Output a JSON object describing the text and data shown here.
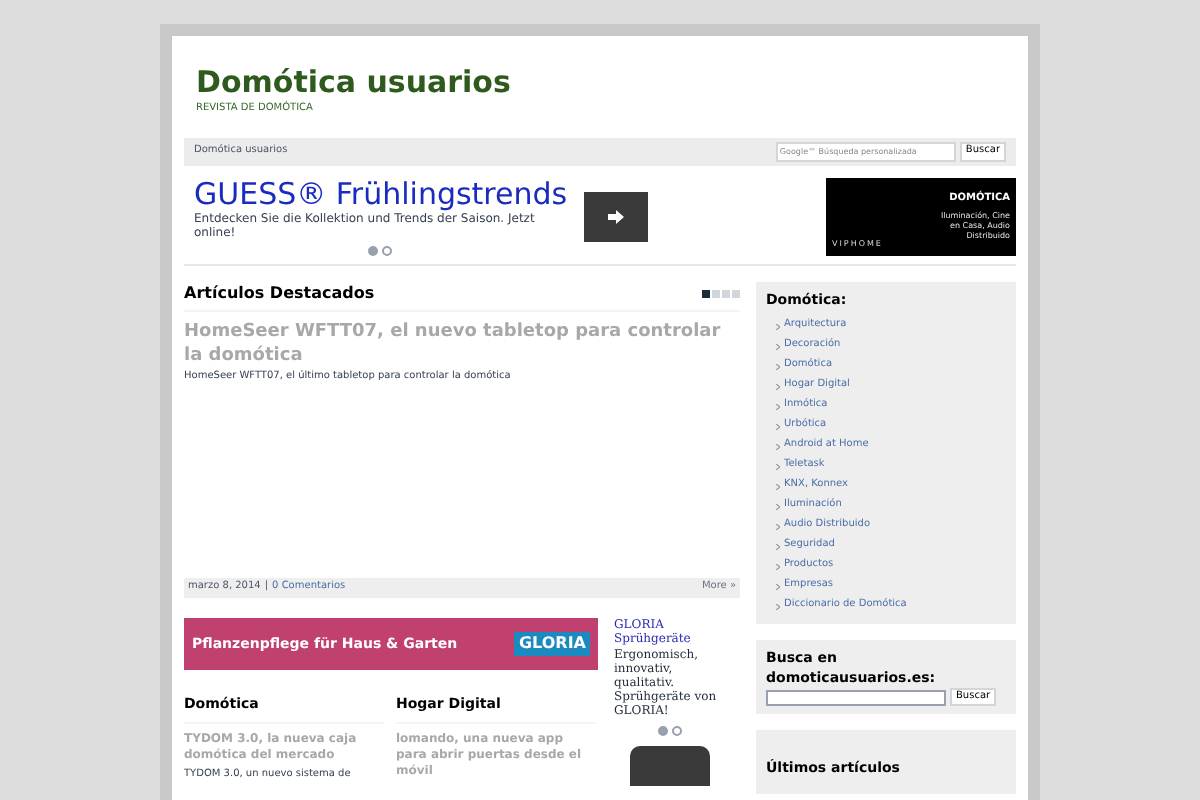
{
  "site": {
    "title": "Domótica usuarios",
    "tagline": "REVISTA DE DOMÓTICA"
  },
  "nav": {
    "breadcrumb": "Domótica usuarios",
    "search_placeholder": "Google™ Búsqueda personalizada",
    "search_button": "Buscar"
  },
  "top_ad": {
    "headline": "GUESS® Frühlingstrends",
    "text": "Entdecken Sie die Kollektion und Trends der Saison. Jetzt online!",
    "dots": [
      {
        "selected": true
      },
      {
        "selected": false
      }
    ]
  },
  "side_ad": {
    "title": "DOMÓTICA",
    "text": "Iluminación, Cine en Casa, Audio Distribuido",
    "brand": "VIPHOME"
  },
  "featured": {
    "heading": "Artículos Destacados",
    "pager": [
      {
        "selected": true
      },
      {
        "selected": false
      },
      {
        "selected": false
      },
      {
        "selected": false
      }
    ],
    "title": "HomeSeer WFTT07, el nuevo tabletop para controlar la domótica",
    "excerpt": "HomeSeer WFTT07, el último tabletop para controlar la domótica",
    "date": "marzo 8, 2014",
    "separator": "|",
    "comments": "0 Comentarios",
    "more": "More »"
  },
  "banner_ad": {
    "text": "Pflanzenpflege für Haus & Garten",
    "brand": "GLORIA"
  },
  "text_ad": {
    "title": "GLORIA Sprühgeräte",
    "text": "Ergonomisch, innovativ, qualitativ. Sprühgeräte von GLORIA!",
    "dots": [
      {
        "selected": true
      },
      {
        "selected": false
      }
    ]
  },
  "columns": [
    {
      "heading": "Domótica",
      "title": "TYDOM 3.0, la nueva caja domótica del mercado",
      "excerpt": "TYDOM 3.0, un nuevo sistema de"
    },
    {
      "heading": "Hogar Digital",
      "title": "lomando, una nueva app para abrir puertas desde el móvil"
    }
  ],
  "sidebar": {
    "categories_heading": "Domótica:",
    "categories": [
      "Arquitectura",
      "Decoración",
      "Domótica",
      "Hogar Digital",
      "Inmótica",
      "Urbótica",
      "Android at Home",
      "Teletask",
      "KNX, Konnex",
      "Iluminación",
      "Audio Distribuido",
      "Seguridad",
      "Productos",
      "Empresas",
      "Diccionario de Domótica"
    ],
    "search_heading": "Busca en domoticausuarios.es:",
    "search_button": "Buscar",
    "latest_heading": "Últimos artículos"
  }
}
